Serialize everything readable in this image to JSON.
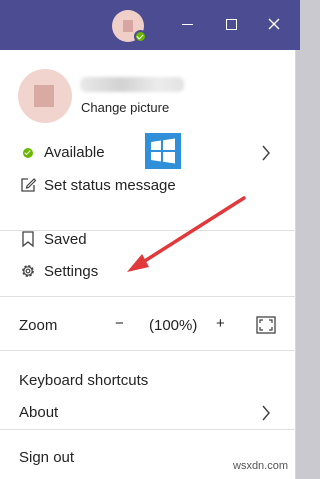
{
  "menu": {
    "change_picture": "Change picture",
    "status": "Available",
    "set_status": "Set status message",
    "saved": "Saved",
    "settings": "Settings",
    "zoom_label": "Zoom",
    "zoom_minus": "−",
    "zoom_value": "(100%)",
    "zoom_plus": "+",
    "keyboard_shortcuts": "Keyboard shortcuts",
    "about": "About",
    "sign_out": "Sign out"
  },
  "watermark": "wsxdn.com",
  "colors": {
    "titlebar": "#4b4c92",
    "status_available": "#6bb700",
    "annotation_arrow": "#e0383b"
  },
  "icons": {
    "status": "green-check-dot",
    "set_status": "edit-note-icon",
    "saved": "bookmark-icon",
    "settings": "gear-icon",
    "zoom_fit": "fullscreen-icon",
    "submenu": "chevron-right-icon"
  }
}
